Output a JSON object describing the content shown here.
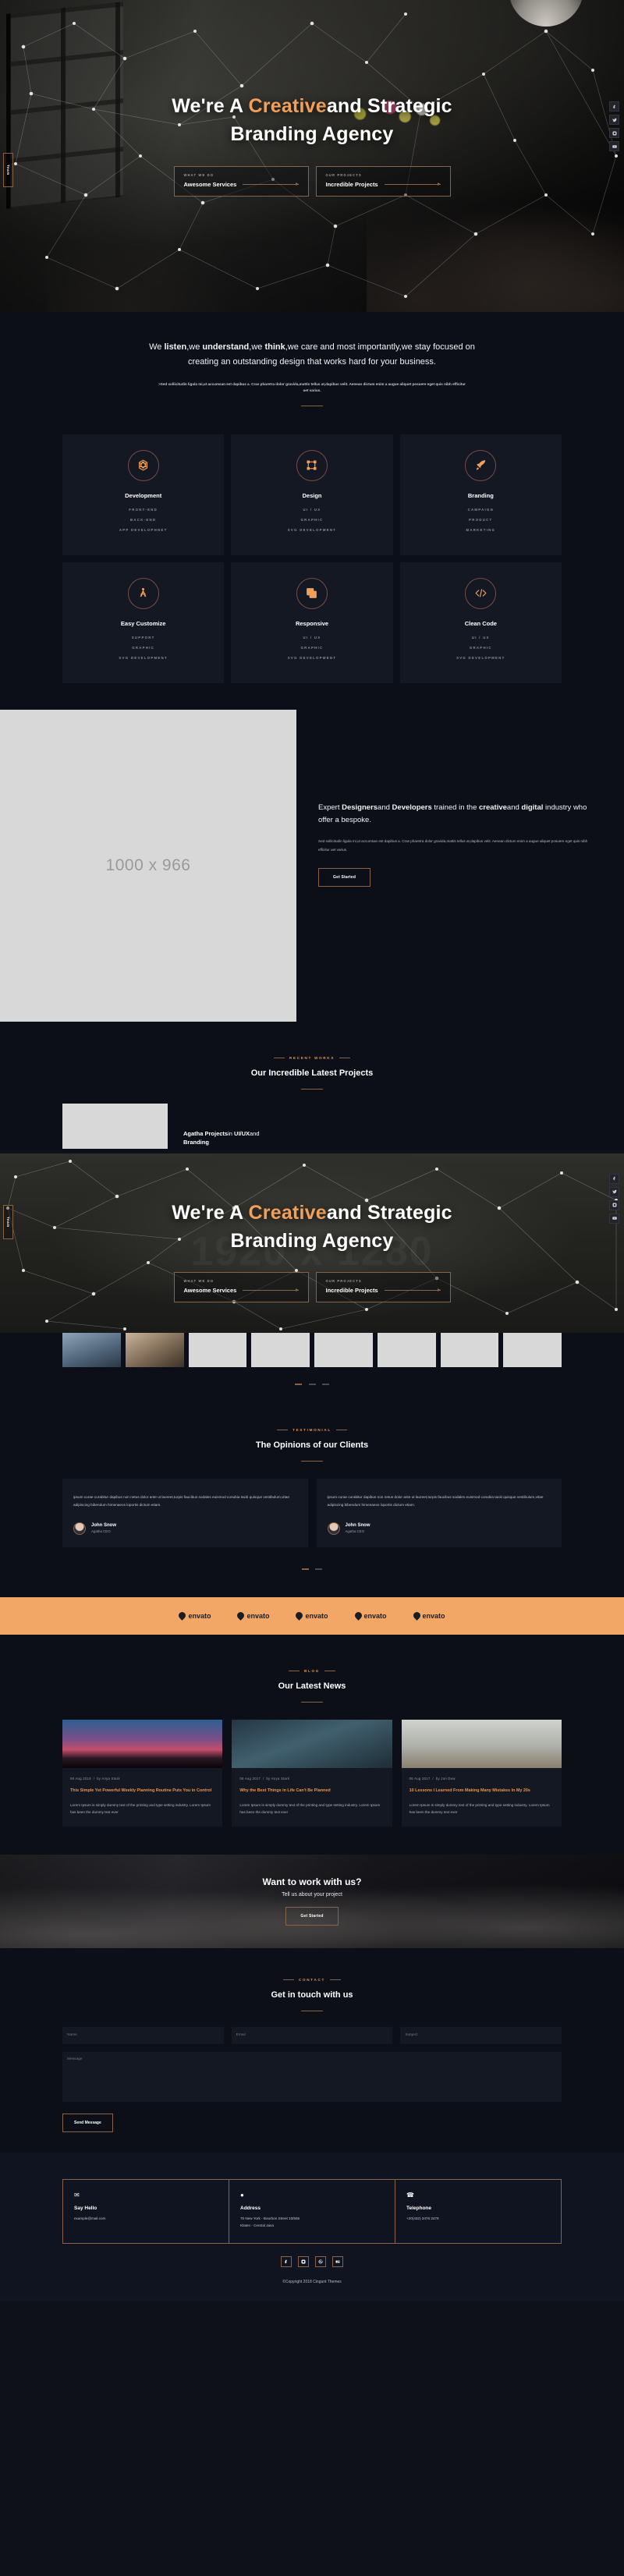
{
  "hero": {
    "title_part1": "We're A ",
    "title_accent": "Creative",
    "title_part2": "and Strategic",
    "title_line2": "Branding Agency",
    "side_tab": "Team",
    "buttons": [
      {
        "sub": "WHAT WE DO",
        "label": "Awesome Services"
      },
      {
        "sub": "OUR PROJECTS",
        "label": "Incredible Projects"
      }
    ],
    "social": [
      "facebook-icon",
      "twitter-icon",
      "instagram-icon",
      "youtube-icon"
    ],
    "ghost_text": "1920 x 1280"
  },
  "intro": {
    "lead_1": "We ",
    "lead_b1": "listen",
    "lead_2": ",we ",
    "lead_b2": "understand",
    "lead_3": ",we ",
    "lead_b3": "think",
    "lead_4": ",we care and most importantly,we stay focused on creating an outstanding design that works hard for your business.",
    "sub": ">Sed sollicitudin ligula mi,ut accumsan est dapibus a. Cras pharetra dolor gravida,mattis tellus at,dapibus velit. Aenean dictum enim a augue aliquet posuere eget quis nibh efficitur uet varius."
  },
  "services": [
    {
      "icon": "hexagon-network-icon",
      "title": "Development",
      "items": [
        "FRONT-END",
        "BACK-END",
        "APP DEVELOPHNET"
      ]
    },
    {
      "icon": "crop-frame-icon",
      "title": "Design",
      "items": [
        "UI / UX",
        "GRAPHIC",
        "SVG DEVELOPMENT"
      ]
    },
    {
      "icon": "rocket-icon",
      "title": "Branding",
      "items": [
        "CAMPAIGN",
        "PRODUCT",
        "MARKETING"
      ]
    },
    {
      "icon": "compass-icon",
      "title": "Easy Customize",
      "items": [
        "SUPPORT",
        "GRAPHIC",
        "SVG DEVELOPMENT"
      ]
    },
    {
      "icon": "layers-icon",
      "title": "Responsive",
      "items": [
        "UI / UX",
        "GRAPHIC",
        "SVG DEVELOPMENT"
      ]
    },
    {
      "icon": "code-icon",
      "title": "Clean Code",
      "items": [
        "UI / UX",
        "GRAPHIC",
        "SVG DEVELOPMENT"
      ]
    }
  ],
  "about": {
    "placeholder": "1000 x 966",
    "h_1": "Expert ",
    "h_b1": "Designers",
    "h_2": "and ",
    "h_b2": "Developers",
    "h_3": " trained in the ",
    "h_b3": "creative",
    "h_4": "and ",
    "h_b4": "digital",
    "h_5": " industry who offer a bespoke.",
    "body": "Sed sollicitudin ligula mi,ut accumsan est dapibus a. Cras pharetra dolor gravida,mattis tellus at,dapibus velit. Aenean dictum enim a augue aliquet posuere eget quis nibh efficitur uet varius.",
    "cta": "Get Started"
  },
  "projects": {
    "eyebrow": "RECENT WORKS",
    "title": "Our Incredible Latest Projects",
    "caption_b1": "Agatha Projects",
    "caption_1": "in ",
    "caption_b2": "UI/UX",
    "caption_2": "and",
    "caption_line2": "Branding"
  },
  "testimonials": {
    "eyebrow": "TESTIMONIAL",
    "title": "The Opinions of our Clients",
    "cards": [
      {
        "quote": "ipsum curae curabitur dapibus non netus dolor ante ut laoreet,turpis faucibus sodales euismod conubia taciti quisque vestibulum,vitae adipiscing bibendum himenaeos loportis dictum etiam.",
        "name": "John Snow",
        "role": "Agatha CEO"
      },
      {
        "quote": "ipsum curae curabitur dapibus non netus dolor ante ut laoreet,turpis faucibus sodales euismod conubia taciti quisque vestibulum,vitae adipiscing bibendum himenaeos loportis dictum etiam.",
        "name": "John Snow",
        "role": "Agatha CEO"
      }
    ]
  },
  "clients": [
    "envato",
    "envato",
    "envato",
    "envato",
    "envato"
  ],
  "blog": {
    "eyebrow": "BLOG",
    "title": "Our Latest News",
    "posts": [
      {
        "date": "06 Aug 2018",
        "author": "by Anya Stark",
        "title": "This Simple Yet Powerful Weekly Planning Routine Puts You in Control",
        "excerpt": "Lorem Ipsum is simply dummy text of the printing and type setting industry. Lorem Ipsum has been the dummy text ever"
      },
      {
        "date": "06 Aug 2017",
        "author": "by Anya Stark",
        "title": "Why the Best Things in Life Can't Be Planned",
        "excerpt": "Lorem Ipsum is simply dummy text of the printing and type setting industry. Lorem Ipsum has been the dummy text ever"
      },
      {
        "date": "06 Aug 2017",
        "author": "by Jon Dew",
        "title": "10 Lessons I Learned From Making Many Mistakes In My 20s",
        "excerpt": "Lorem Ipsum is simply dummy text of the printing and type setting industry. Lorem Ipsum has been the dummy text ever"
      }
    ]
  },
  "cta": {
    "title": "Want to work with us?",
    "subtitle": "Tell us about your project",
    "button": "Get Started"
  },
  "contact": {
    "eyebrow": "CONTACT",
    "title": "Get in touch with us",
    "name_placeholder": "Name",
    "email_placeholder": "Email",
    "subject_placeholder": "Subject",
    "message_placeholder": "Message",
    "submit": "Send Message"
  },
  "footer": {
    "cells": [
      {
        "icon": "mail-icon",
        "title": "Say Hello",
        "line1": "example@mail.com",
        "line2": ""
      },
      {
        "icon": "map-pin-icon",
        "title": "Address",
        "line1": "75 New York - Bourbon Street 10/555",
        "line2": "Klaten - Central Java"
      },
      {
        "icon": "phone-icon",
        "title": "Telephone",
        "line1": "+20(432) 3476 3479",
        "line2": ""
      }
    ],
    "social": [
      "facebook-icon",
      "instagram-icon",
      "dribbble-icon",
      "behance-icon"
    ],
    "copyright": "©Copyright 2018 Cingunt Themes"
  },
  "colors": {
    "accent": "#f0a05a",
    "accent_border": "#8a6246",
    "bg": "#0c0f17",
    "card": "#141823",
    "clients_band": "#f3a766"
  }
}
